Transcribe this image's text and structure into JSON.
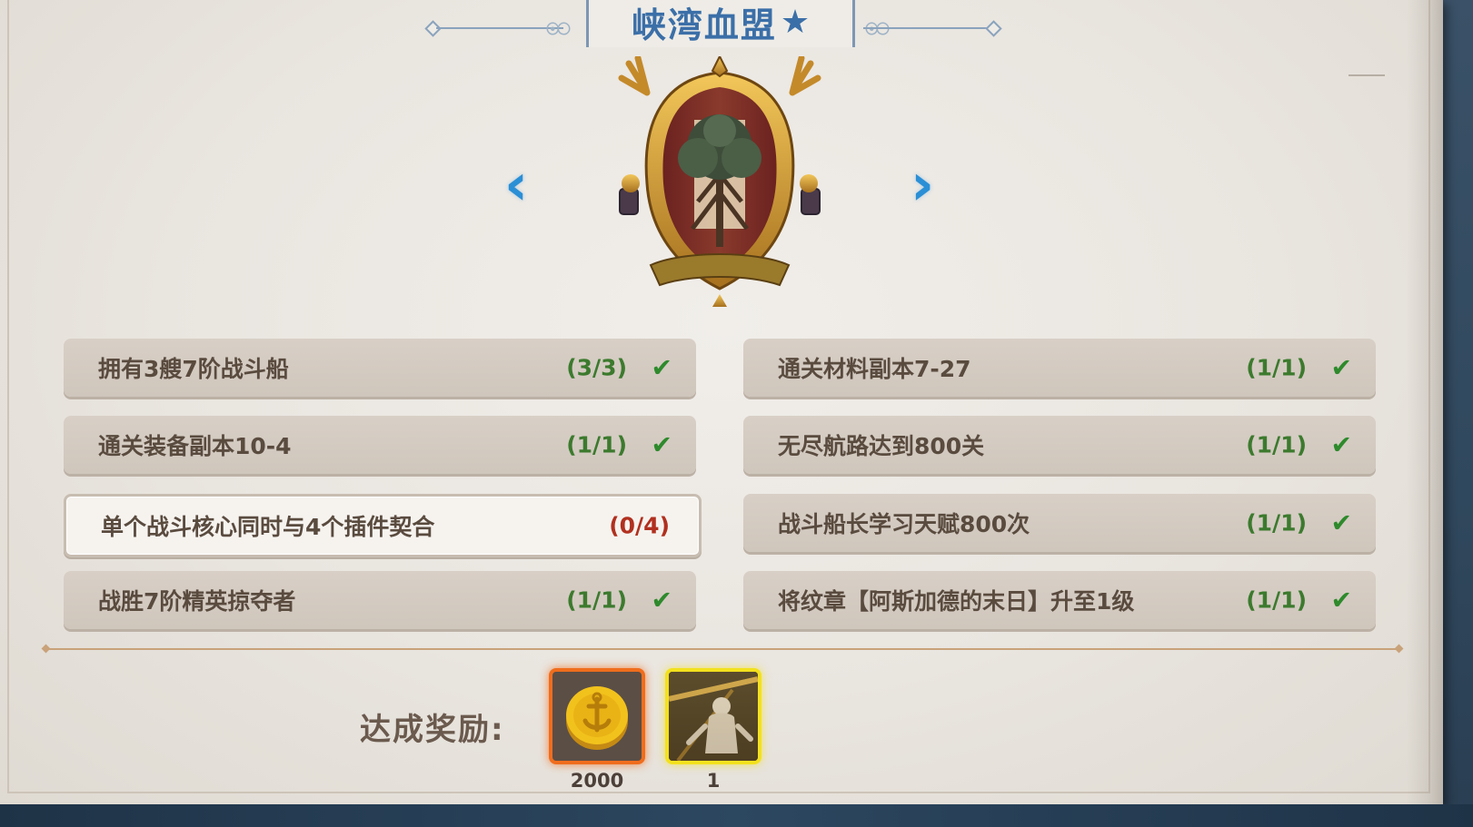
{
  "title": {
    "text": "峡湾血盟",
    "star": "★"
  },
  "nav": {
    "prev_icon": "chevron-left-icon",
    "next_icon": "chevron-right-icon",
    "prev_glyph": "‹",
    "next_glyph": "›"
  },
  "emblem": {
    "icon": "tree-crest-emblem-icon"
  },
  "requirements": [
    {
      "text": "拥有3艘7阶战斗船",
      "progress": "(3/3)",
      "done": true
    },
    {
      "text": "通关材料副本7-27",
      "progress": "(1/1)",
      "done": true
    },
    {
      "text": "通关装备副本10-4",
      "progress": "(1/1)",
      "done": true
    },
    {
      "text": "无尽航路达到800关",
      "progress": "(1/1)",
      "done": true
    },
    {
      "text": "单个战斗核心同时与4个插件契合",
      "progress": "(0/4)",
      "done": false
    },
    {
      "text": "战斗船长学习天赋800次",
      "progress": "(1/1)",
      "done": true
    },
    {
      "text": "战胜7阶精英掠夺者",
      "progress": "(1/1)",
      "done": true
    },
    {
      "text": "将纹章【阿斯加德的末日】升至1级",
      "progress": "(1/1)",
      "done": true
    }
  ],
  "check_glyph": "✔",
  "reward": {
    "label": "达成奖励:",
    "items": [
      {
        "icon": "gold-coin-icon",
        "quantity": "2000",
        "rarity_color": "#f06d1d"
      },
      {
        "icon": "warrior-figure-icon",
        "quantity": "1",
        "rarity_color": "#f3e11d"
      }
    ]
  },
  "colors": {
    "title": "#3b6fa8",
    "arrow": "#2b8fd6",
    "done": "#3c7a2e",
    "pending": "#b1301f"
  }
}
